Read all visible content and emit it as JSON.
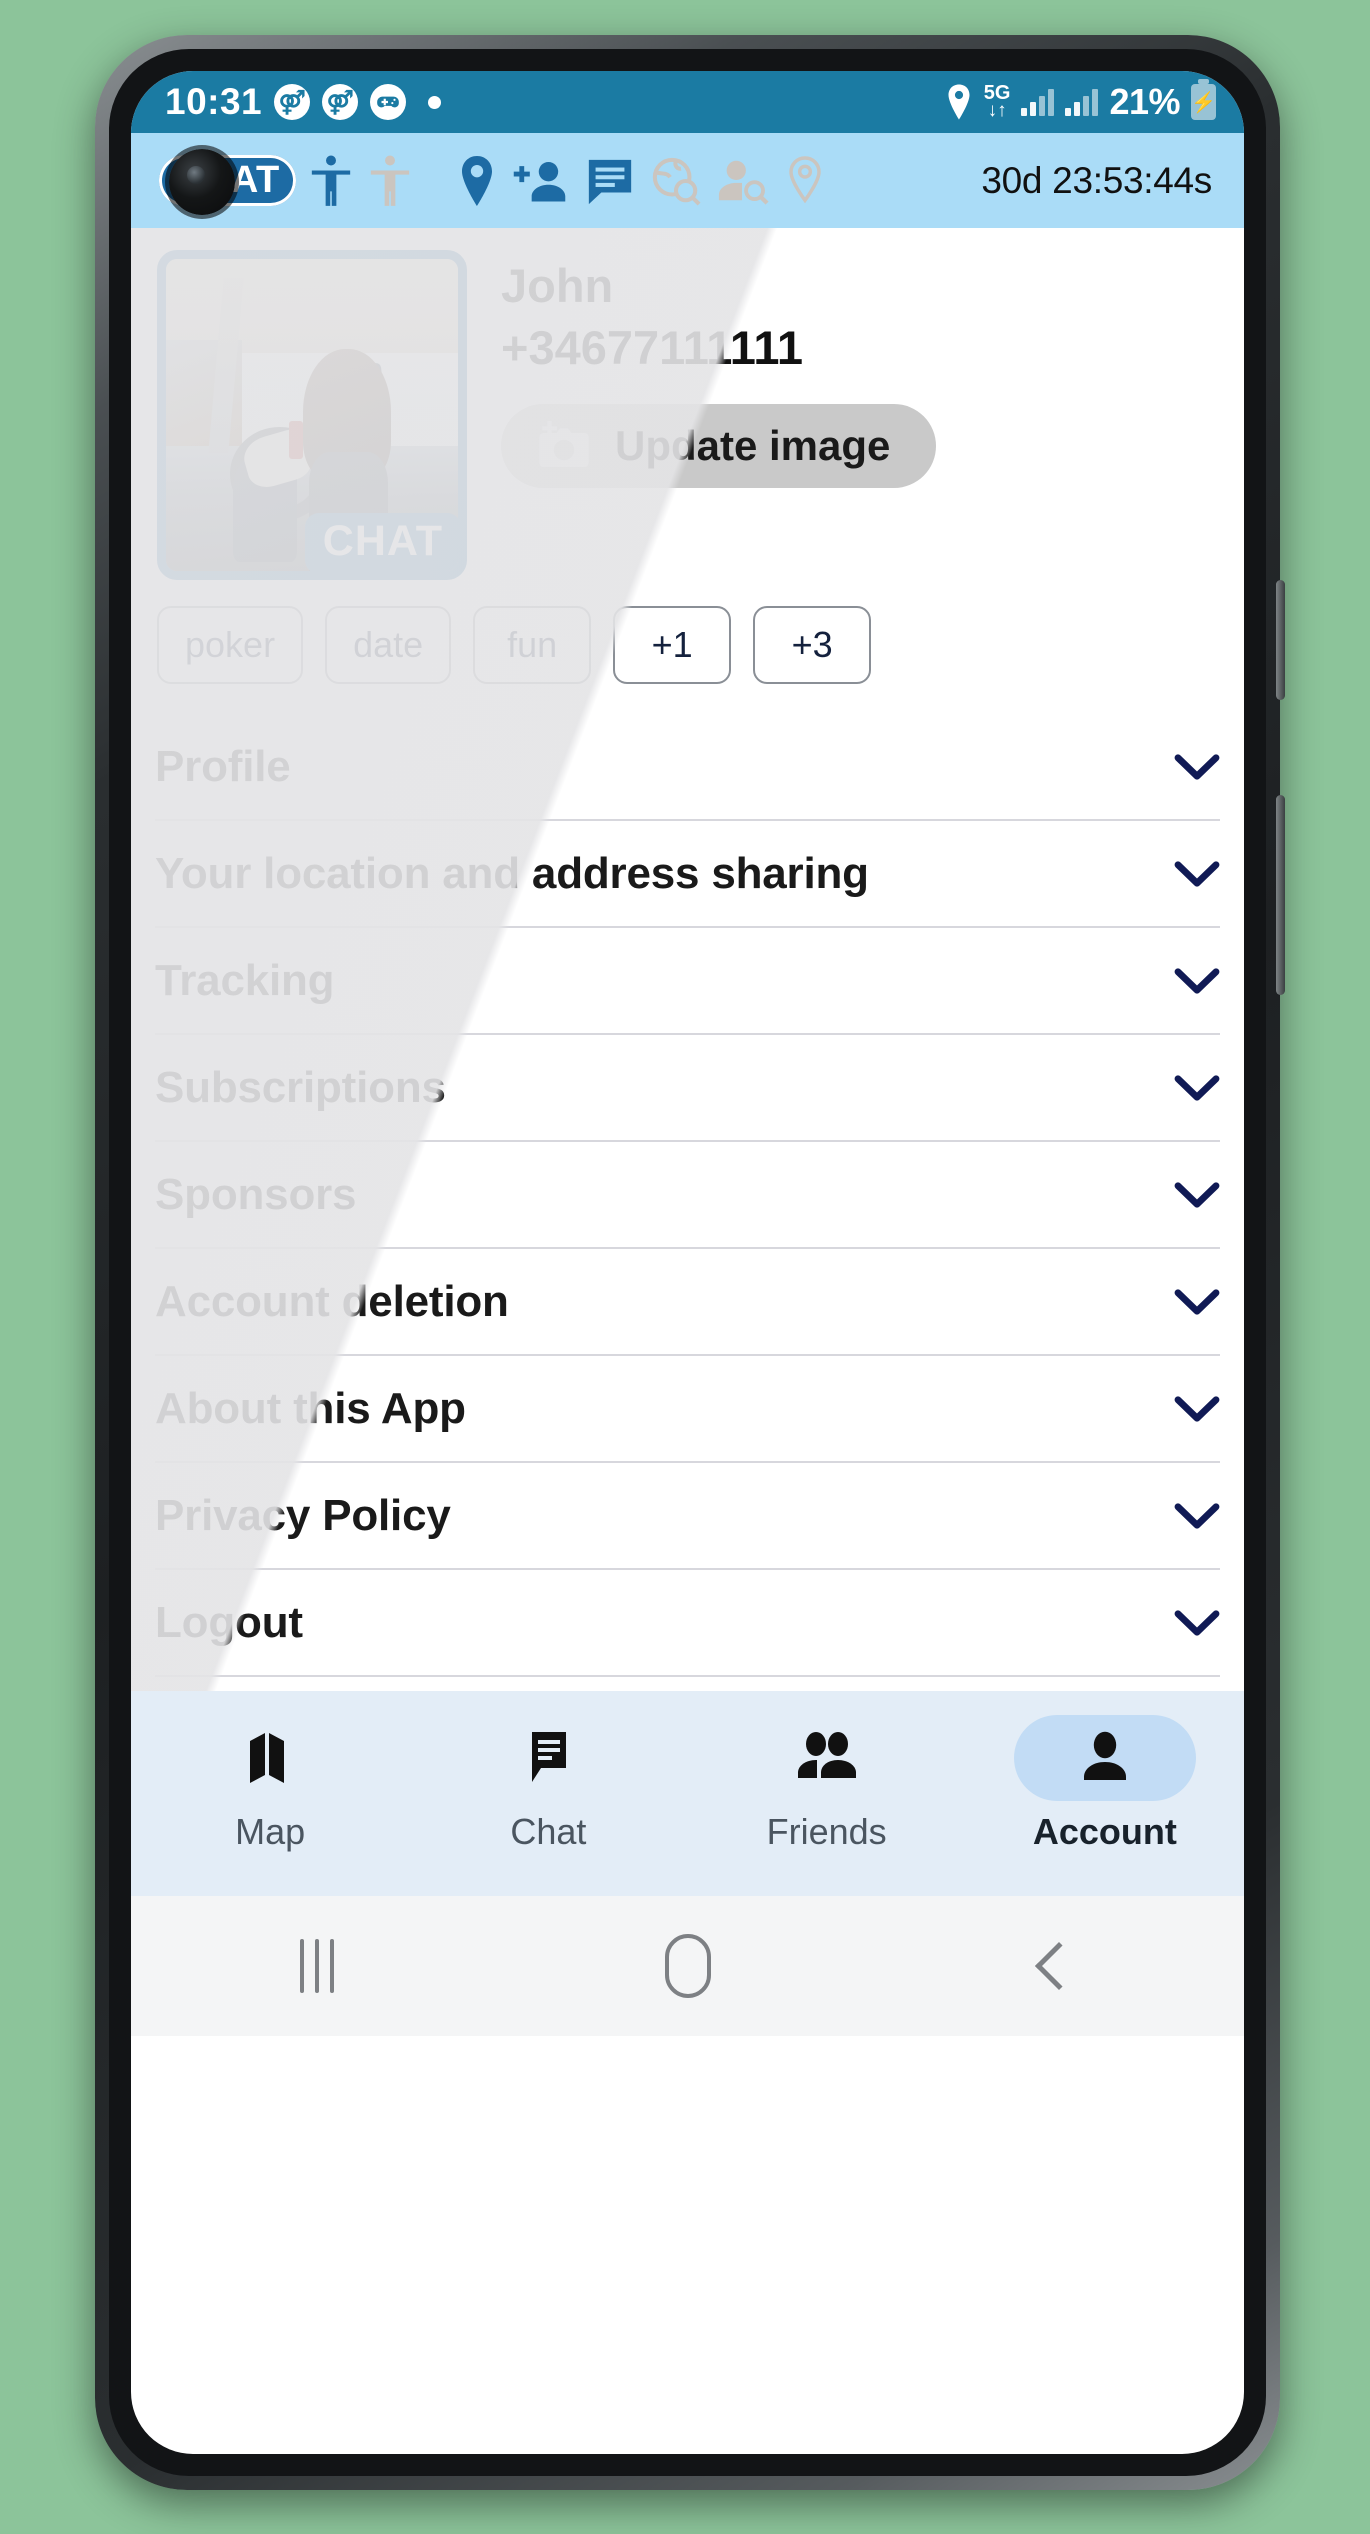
{
  "status_bar": {
    "clock": "10:31",
    "notification_icons": [
      "accessibility-badge-icon",
      "accessibility-badge-icon",
      "game-controller-icon",
      "dot-indicator"
    ],
    "location_icon": "location-pin-icon",
    "network_type": "5G",
    "network_arrows": "↓↑",
    "battery_percent": "21%",
    "battery_icon": "battery-charging-icon"
  },
  "toolbar": {
    "chat_badge": "CHAT",
    "icons": [
      "person-visible-active-icon",
      "person-invisible-icon",
      "location-pin-icon",
      "add-person-icon",
      "chat-bubble-icon",
      "globe-search-icon",
      "person-search-icon",
      "pin-search-icon"
    ],
    "timer": "30d 23:53:44s"
  },
  "profile": {
    "avatar_badge": "CHAT",
    "name": "John",
    "phone": "+34677111111",
    "update_button": "Update image",
    "update_button_icon": "add-photo-camera-icon"
  },
  "chips": [
    {
      "label": "poker"
    },
    {
      "label": "date"
    },
    {
      "label": "fun"
    },
    {
      "label": "+1"
    },
    {
      "label": "+3"
    }
  ],
  "sections": [
    {
      "label": "Profile"
    },
    {
      "label": "Your location and address sharing"
    },
    {
      "label": "Tracking"
    },
    {
      "label": "Subscriptions"
    },
    {
      "label": "Sponsors"
    },
    {
      "label": "Account deletion"
    },
    {
      "label": "About this App"
    },
    {
      "label": "Privacy Policy"
    },
    {
      "label": "Logout"
    }
  ],
  "bottom_nav": {
    "items": [
      {
        "label": "Map",
        "icon": "map-icon",
        "active": false
      },
      {
        "label": "Chat",
        "icon": "chat-icon",
        "active": false
      },
      {
        "label": "Friends",
        "icon": "friends-icon",
        "active": false
      },
      {
        "label": "Account",
        "icon": "account-icon",
        "active": true
      }
    ]
  },
  "android_nav": {
    "recents": "recents-icon",
    "home": "home-icon",
    "back": "back-icon"
  },
  "colors": {
    "status_bar": "#1b7ba3",
    "toolbar": "#aadcf7",
    "accent_blue": "#1a6aa6",
    "bottom_nav": "#e3edf7",
    "active_pill": "#c2dcf5",
    "chevron": "#101a55"
  }
}
